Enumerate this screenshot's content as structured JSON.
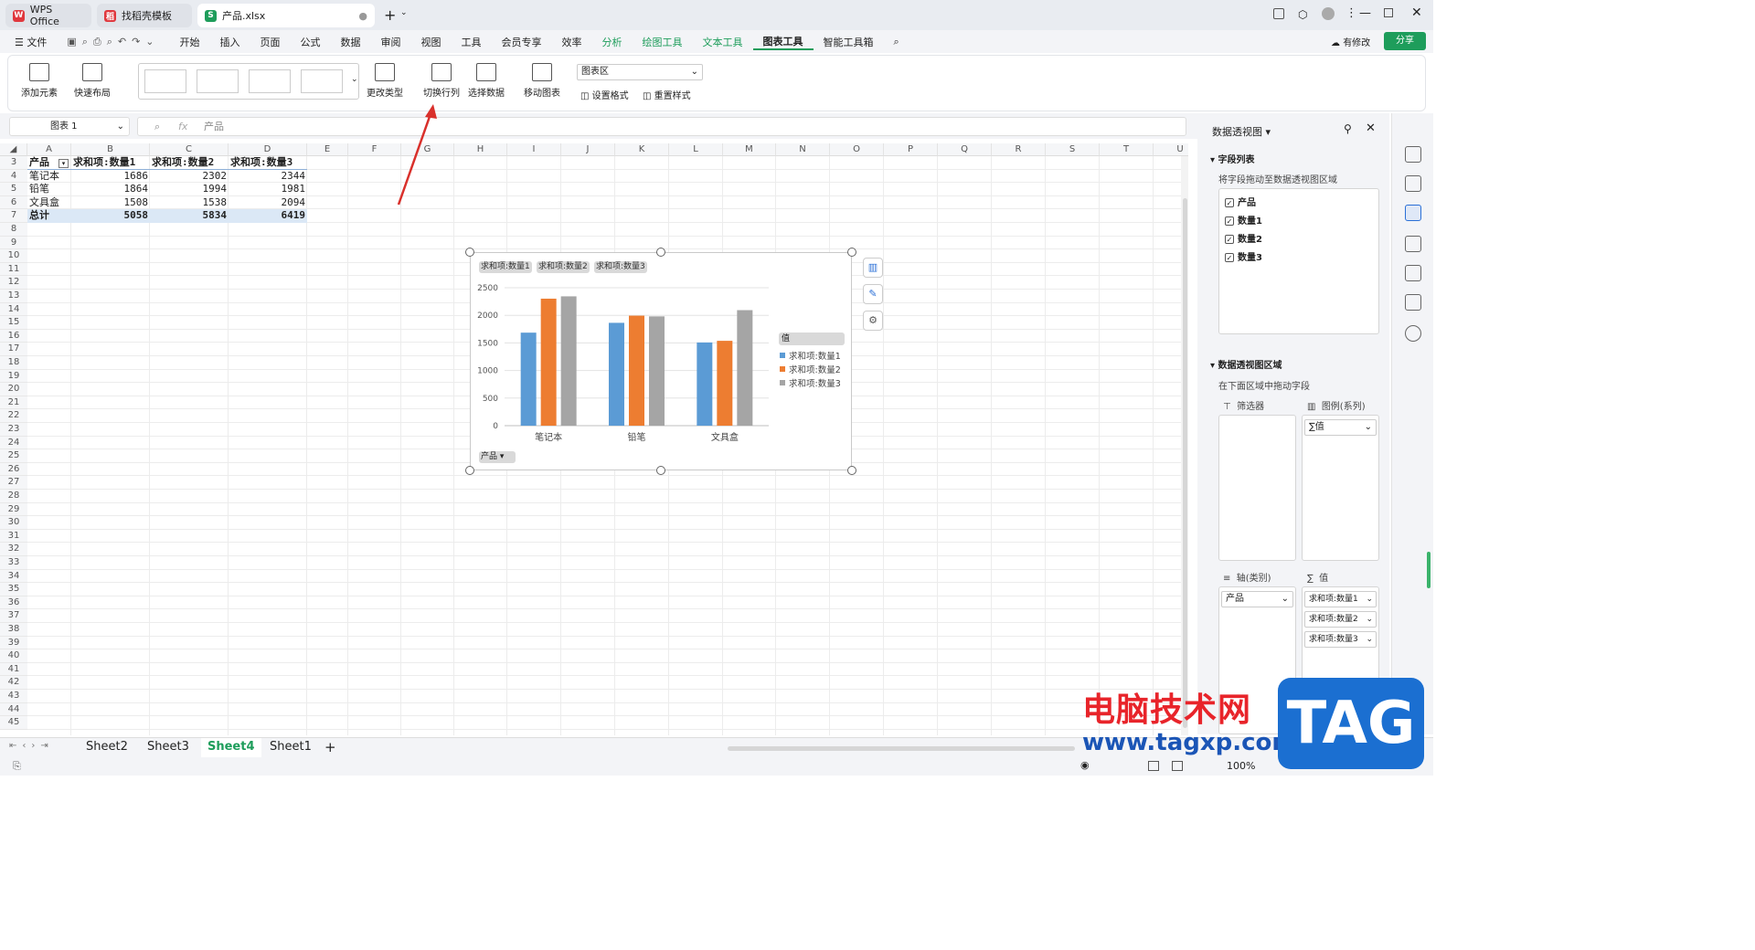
{
  "titlebar": {
    "tabs": [
      {
        "label": "WPS Office"
      },
      {
        "label": "找稻壳模板"
      },
      {
        "label": "产品.xlsx"
      }
    ]
  },
  "menubar": {
    "items": [
      "文件",
      "开始",
      "插入",
      "页面",
      "公式",
      "数据",
      "审阅",
      "视图",
      "工具",
      "会员专享",
      "效率",
      "分析",
      "绘图工具",
      "文本工具",
      "图表工具",
      "智能工具箱"
    ],
    "modify": "有修改",
    "share": "分享"
  },
  "ribbon": {
    "add_element": "添加元素",
    "quick_layout": "快速布局",
    "change_type": "更改类型",
    "switch_rowcol": "切换行列",
    "select_data": "选择数据",
    "move_chart": "移动图表",
    "chart_area": "图表区",
    "set_format": "设置格式",
    "reset_style": "重置样式"
  },
  "formulabar": {
    "name_box": "图表 1",
    "fx": "fx",
    "content": "产品"
  },
  "sheet": {
    "columns": [
      "A",
      "B",
      "C",
      "D",
      "E",
      "F",
      "G",
      "H",
      "I",
      "J",
      "K",
      "L",
      "M",
      "N",
      "O",
      "P",
      "Q",
      "R",
      "S",
      "T",
      "U"
    ],
    "rows": [
      "3",
      "4",
      "5",
      "6",
      "7",
      "8",
      "9",
      "10",
      "11",
      "12",
      "13",
      "14",
      "15",
      "16",
      "17",
      "18",
      "19",
      "20",
      "21",
      "22",
      "23",
      "24",
      "25",
      "26",
      "27",
      "28",
      "29",
      "30",
      "31",
      "32",
      "33",
      "34",
      "35",
      "36",
      "37",
      "38",
      "39",
      "40",
      "41",
      "42",
      "43",
      "44",
      "45"
    ],
    "header": [
      "产品",
      "求和项:数量1",
      "求和项:数量2",
      "求和项:数量3"
    ],
    "data": [
      [
        "笔记本",
        "1686",
        "2302",
        "2344"
      ],
      [
        "铅笔",
        "1864",
        "1994",
        "1981"
      ],
      [
        "文具盒",
        "1508",
        "1538",
        "2094"
      ]
    ],
    "total": [
      "总计",
      "5058",
      "5834",
      "6419"
    ]
  },
  "chart_data": {
    "type": "bar",
    "categories": [
      "笔记本",
      "铅笔",
      "文具盒"
    ],
    "series": [
      {
        "name": "求和项:数量1",
        "values": [
          1686,
          1864,
          1508
        ],
        "color": "#5b9bd5"
      },
      {
        "name": "求和项:数量2",
        "values": [
          2302,
          1994,
          1538
        ],
        "color": "#ed7d31"
      },
      {
        "name": "求和项:数量3",
        "values": [
          2344,
          1981,
          2094
        ],
        "color": "#a5a5a5"
      }
    ],
    "ylim": [
      0,
      2500
    ],
    "yticks": [
      "2500",
      "2000",
      "1500",
      "1000",
      "500",
      "0"
    ],
    "legend_title": "值",
    "legend_placement": "right",
    "field_button": "产品",
    "grid": true
  },
  "pivot_panel": {
    "title": "数据透视图",
    "field_list": "字段列表",
    "drag_hint": "将字段拖动至数据透视图区域",
    "fields": [
      "产品",
      "数量1",
      "数量2",
      "数量3"
    ],
    "areas_title": "数据透视图区域",
    "areas_hint": "在下面区域中拖动字段",
    "filter": "筛选器",
    "legend": "图例(系列)",
    "axis": "轴(类别)",
    "values": "值",
    "legend_item": "∑值",
    "axis_item": "产品",
    "value_items": [
      "求和项:数量1",
      "求和项:数量2",
      "求和项:数量3"
    ]
  },
  "sheettabs": [
    "Sheet2",
    "Sheet3",
    "Sheet4",
    "Sheet1"
  ],
  "status": {
    "zoom": "100%"
  },
  "watermark": {
    "cn": "电脑技术网",
    "url": "www.tagxp.com",
    "tag": "TAG"
  }
}
